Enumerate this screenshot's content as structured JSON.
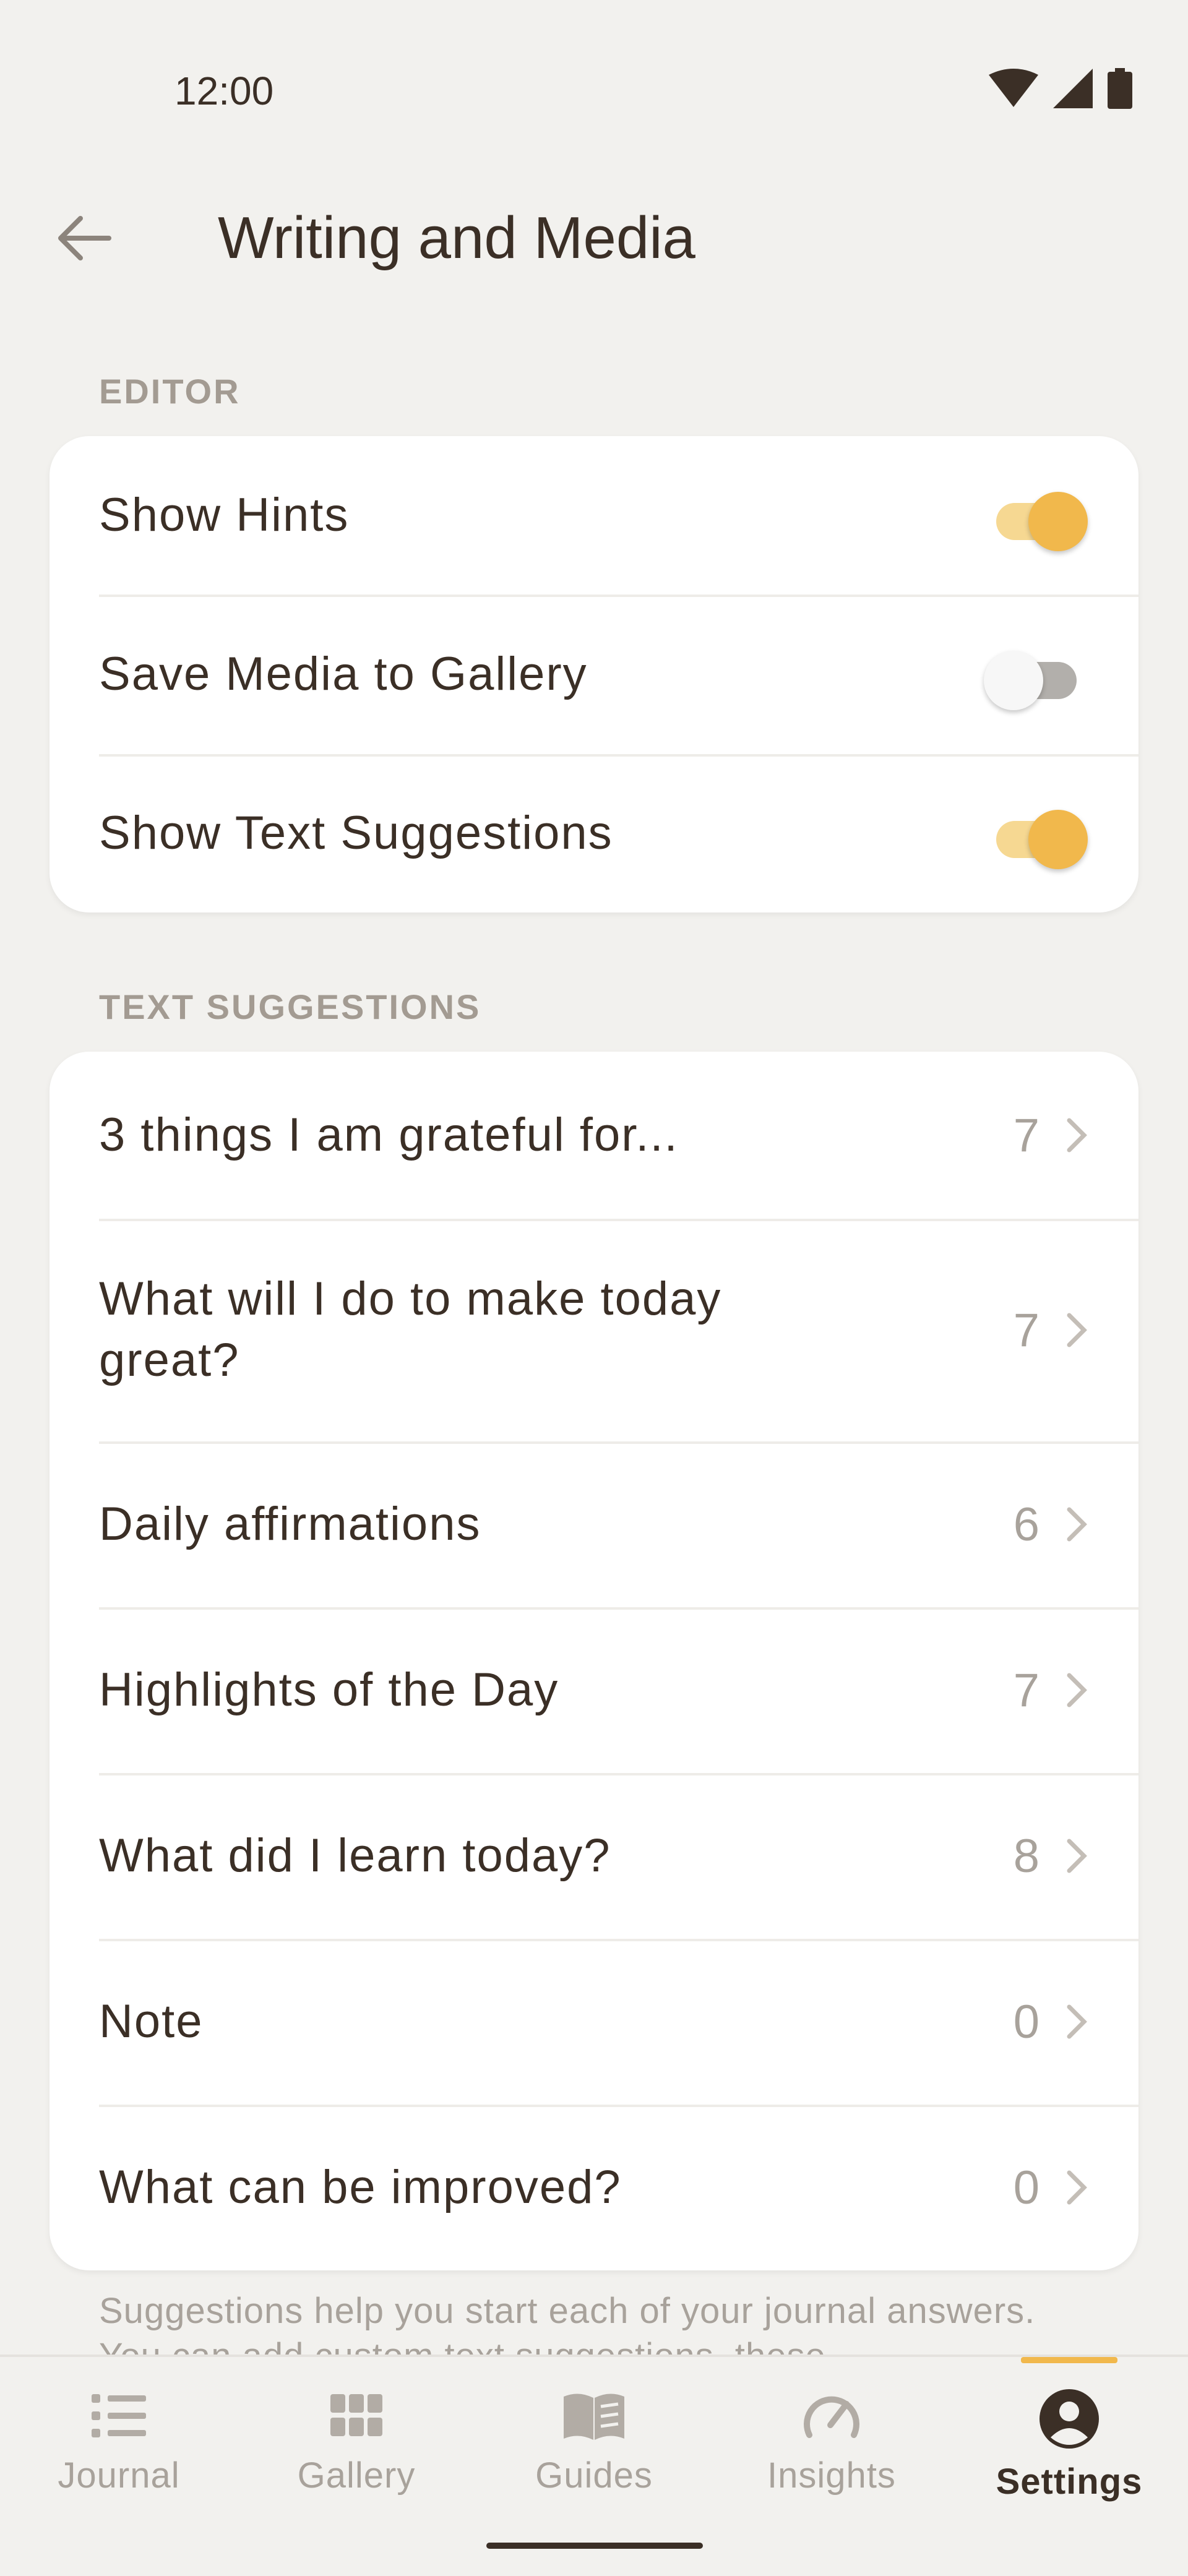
{
  "status_bar": {
    "time": "12:00"
  },
  "app_bar": {
    "title": "Writing and Media"
  },
  "editor": {
    "section_label": "EDITOR",
    "items": [
      {
        "label": "Show Hints",
        "enabled": true
      },
      {
        "label": "Save Media to Gallery",
        "enabled": false
      },
      {
        "label": "Show Text Suggestions",
        "enabled": true
      }
    ]
  },
  "text_suggestions": {
    "section_label": "TEXT SUGGESTIONS",
    "items": [
      {
        "label": "3 things I am grateful for...",
        "count": "7"
      },
      {
        "label": "What will I do to make today great?",
        "count": "7"
      },
      {
        "label": "Daily affirmations",
        "count": "6"
      },
      {
        "label": "Highlights of the Day",
        "count": "7"
      },
      {
        "label": "What did I learn today?",
        "count": "8"
      },
      {
        "label": "Note",
        "count": "0"
      },
      {
        "label": "What can be improved?",
        "count": "0"
      }
    ],
    "footer_note": "Suggestions help you start each of your journal answers. You can add custom text suggestions, these"
  },
  "bottom_nav": {
    "items": [
      {
        "label": "Journal",
        "icon": "list-icon"
      },
      {
        "label": "Gallery",
        "icon": "grid-icon"
      },
      {
        "label": "Guides",
        "icon": "book-icon"
      },
      {
        "label": "Insights",
        "icon": "gauge-icon"
      },
      {
        "label": "Settings",
        "icon": "account-icon"
      }
    ],
    "active": "Settings"
  },
  "colors": {
    "accent": "#f1b84c",
    "text": "#3b2f26",
    "muted": "#a8a29b",
    "background": "#f2f1ee"
  }
}
